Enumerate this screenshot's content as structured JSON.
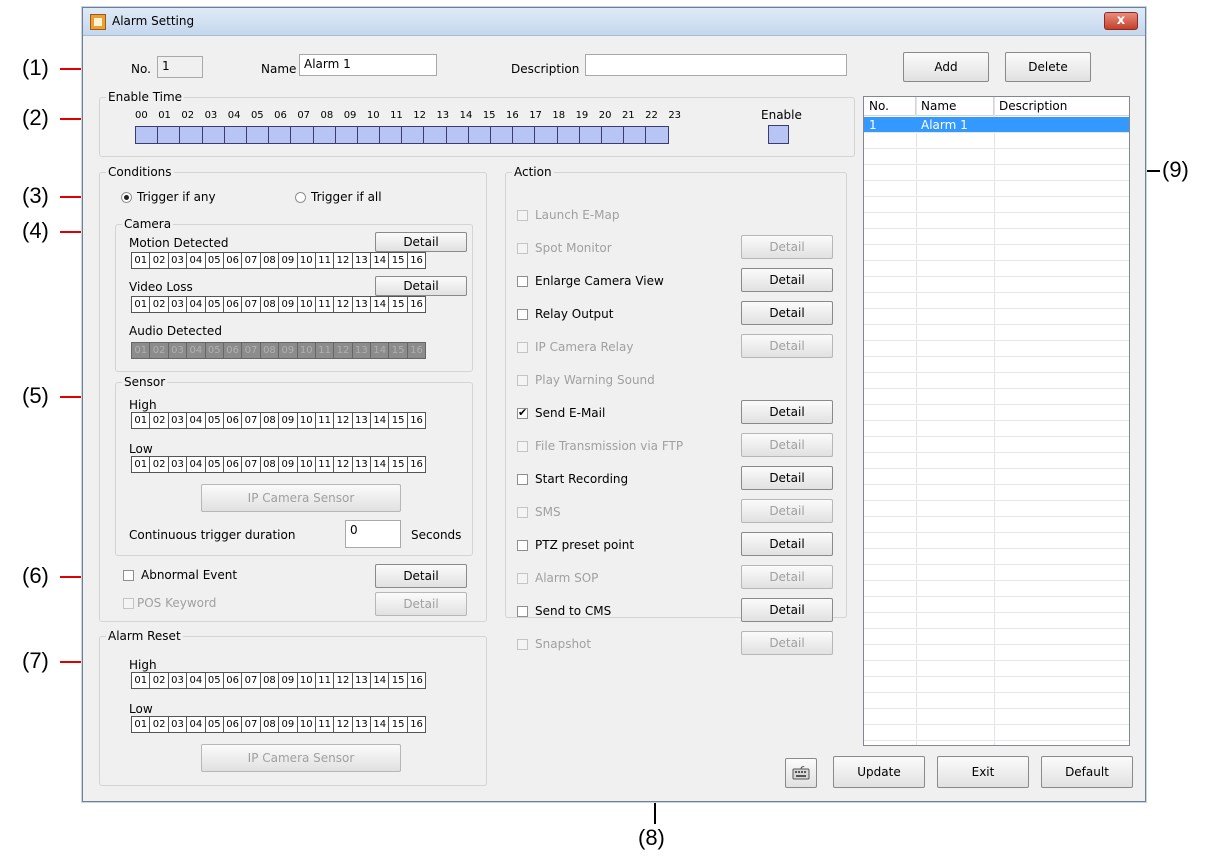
{
  "callouts": [
    "(1)",
    "(2)",
    "(3)",
    "(4)",
    "(5)",
    "(6)",
    "(7)",
    "(8)",
    "(9)"
  ],
  "window": {
    "title": "Alarm Setting",
    "close_glyph": "x"
  },
  "header": {
    "no_label": "No.",
    "no_value": "1",
    "name_label": "Name",
    "name_value": "Alarm 1",
    "description_label": "Description",
    "description_value": "",
    "add_button": "Add",
    "delete_button": "Delete"
  },
  "enable_time": {
    "title": "Enable Time",
    "hours": [
      "00",
      "01",
      "02",
      "03",
      "04",
      "05",
      "06",
      "07",
      "08",
      "09",
      "10",
      "11",
      "12",
      "13",
      "14",
      "15",
      "16",
      "17",
      "18",
      "19",
      "20",
      "21",
      "22",
      "23"
    ],
    "enable_label": "Enable"
  },
  "conditions": {
    "title": "Conditions",
    "trigger_any": "Trigger if any",
    "trigger_all": "Trigger if all",
    "camera": {
      "title": "Camera",
      "motion_label": "Motion Detected",
      "video_loss_label": "Video Loss",
      "audio_label": "Audio Detected",
      "detail": "Detail"
    },
    "sensor": {
      "title": "Sensor",
      "high_label": "High",
      "low_label": "Low",
      "ip_sensor_button": "IP Camera Sensor",
      "continuous_label": "Continuous trigger duration",
      "continuous_value": "0",
      "seconds_label": "Seconds"
    },
    "abnormal_event": "Abnormal Event",
    "pos_keyword": "POS Keyword",
    "detail": "Detail"
  },
  "alarm_reset": {
    "title": "Alarm Reset",
    "high_label": "High",
    "low_label": "Low",
    "ip_sensor_button": "IP Camera Sensor"
  },
  "channels": [
    "01",
    "02",
    "03",
    "04",
    "05",
    "06",
    "07",
    "08",
    "09",
    "10",
    "11",
    "12",
    "13",
    "14",
    "15",
    "16"
  ],
  "action": {
    "title": "Action",
    "detail": "Detail",
    "items": [
      {
        "label": "Launch E-Map",
        "enabled": false,
        "checked": false,
        "has_detail": false
      },
      {
        "label": "Spot Monitor",
        "enabled": false,
        "checked": false,
        "has_detail": true
      },
      {
        "label": "Enlarge Camera View",
        "enabled": true,
        "checked": false,
        "has_detail": true
      },
      {
        "label": "Relay Output",
        "enabled": true,
        "checked": false,
        "has_detail": true
      },
      {
        "label": "IP Camera Relay",
        "enabled": false,
        "checked": false,
        "has_detail": true
      },
      {
        "label": "Play Warning Sound",
        "enabled": false,
        "checked": false,
        "has_detail": false
      },
      {
        "label": "Send E-Mail",
        "enabled": true,
        "checked": true,
        "has_detail": true
      },
      {
        "label": "File Transmission via FTP",
        "enabled": false,
        "checked": false,
        "has_detail": true
      },
      {
        "label": "Start Recording",
        "enabled": true,
        "checked": false,
        "has_detail": true
      },
      {
        "label": "SMS",
        "enabled": false,
        "checked": false,
        "has_detail": true
      },
      {
        "label": "PTZ preset point",
        "enabled": true,
        "checked": false,
        "has_detail": true
      },
      {
        "label": "Alarm SOP",
        "enabled": false,
        "checked": false,
        "has_detail": true
      },
      {
        "label": "Send to CMS",
        "enabled": true,
        "checked": false,
        "has_detail": true
      },
      {
        "label": "Snapshot",
        "enabled": false,
        "checked": false,
        "has_detail": true
      }
    ]
  },
  "alarm_list": {
    "columns": [
      "No.",
      "Name",
      "Description"
    ],
    "rows": [
      {
        "no": "1",
        "name": "Alarm 1",
        "description": ""
      }
    ]
  },
  "footer": {
    "update": "Update",
    "exit": "Exit",
    "default": "Default"
  }
}
